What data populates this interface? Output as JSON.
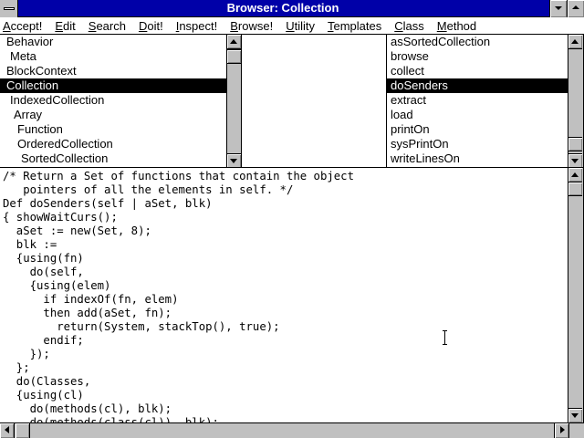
{
  "window": {
    "title": "Browser: Collection"
  },
  "menu": [
    {
      "label": "Accept!",
      "mnemonic": "A",
      "rest": "ccept!"
    },
    {
      "label": "Edit",
      "mnemonic": "E",
      "rest": "dit"
    },
    {
      "label": "Search",
      "mnemonic": "S",
      "rest": "earch"
    },
    {
      "label": "Doit!",
      "mnemonic": "D",
      "rest": "oit!"
    },
    {
      "label": "Inspect!",
      "mnemonic": "I",
      "rest": "nspect!"
    },
    {
      "label": "Browse!",
      "mnemonic": "B",
      "rest": "rowse!"
    },
    {
      "label": "Utility",
      "mnemonic": "U",
      "rest": "tility"
    },
    {
      "label": "Templates",
      "mnemonic": "T",
      "rest": "emplates"
    },
    {
      "label": "Class",
      "mnemonic": "C",
      "rest": "lass"
    },
    {
      "label": "Method",
      "mnemonic": "M",
      "rest": "ethod"
    }
  ],
  "class_list": {
    "items": [
      {
        "label": "Behavior",
        "indent": 0
      },
      {
        "label": "Meta",
        "indent": 1
      },
      {
        "label": "BlockContext",
        "indent": 0
      },
      {
        "label": "Collection",
        "indent": 0,
        "selected": true
      },
      {
        "label": "IndexedCollection",
        "indent": 1
      },
      {
        "label": "Array",
        "indent": 2
      },
      {
        "label": "Function",
        "indent": 3
      },
      {
        "label": "OrderedCollection",
        "indent": 3
      },
      {
        "label": "SortedCollection",
        "indent": 4
      }
    ]
  },
  "method_list": {
    "items": [
      {
        "label": "asSortedCollection"
      },
      {
        "label": "browse"
      },
      {
        "label": "collect"
      },
      {
        "label": "doSenders",
        "selected": true
      },
      {
        "label": "extract"
      },
      {
        "label": "load"
      },
      {
        "label": "printOn"
      },
      {
        "label": "sysPrintOn"
      },
      {
        "label": "writeLinesOn"
      }
    ]
  },
  "editor": {
    "lines": [
      "/* Return a Set of functions that contain the object",
      "   pointers of all the elements in self. */",
      "Def doSenders(self | aSet, blk)",
      "{ showWaitCurs();",
      "  aSet := new(Set, 8);",
      "  blk :=",
      "  {using(fn)",
      "    do(self,",
      "    {using(elem)",
      "      if indexOf(fn, elem)",
      "      then add(aSet, fn);",
      "        return(System, stackTop(), true);",
      "      endif;",
      "    });",
      "  };",
      "  do(Classes,",
      "  {using(cl)",
      "    do(methods(cl), blk);",
      "    do(methods(class(cl)), blk);"
    ]
  },
  "icons": {
    "system_menu": "system-menu-icon",
    "minimize": "minimize-icon",
    "maximize": "maximize-icon",
    "cursor": "ibeam-cursor-icon"
  },
  "colors": {
    "title_bar": "#0000a8",
    "selection": "#000000",
    "chrome": "#c0c0c0"
  }
}
